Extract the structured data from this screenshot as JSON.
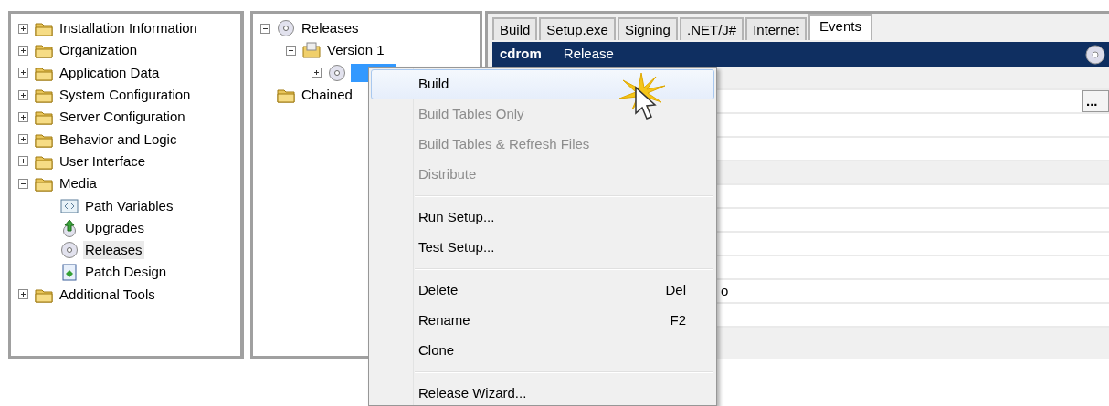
{
  "left_tree": {
    "items": [
      {
        "label": "Installation Information",
        "kind": "folder",
        "expanded": false
      },
      {
        "label": "Organization",
        "kind": "folder",
        "expanded": false
      },
      {
        "label": "Application Data",
        "kind": "folder",
        "expanded": false
      },
      {
        "label": "System Configuration",
        "kind": "folder",
        "expanded": false
      },
      {
        "label": "Server Configuration",
        "kind": "folder",
        "expanded": false
      },
      {
        "label": "Behavior and Logic",
        "kind": "folder",
        "expanded": false
      },
      {
        "label": "User Interface",
        "kind": "folder",
        "expanded": false
      },
      {
        "label": "Media",
        "kind": "folder",
        "expanded": true,
        "children": [
          {
            "label": "Path Variables",
            "kind": "path",
            "selected": false
          },
          {
            "label": "Upgrades",
            "kind": "upgrade",
            "selected": false
          },
          {
            "label": "Releases",
            "kind": "disc",
            "selected": true
          },
          {
            "label": "Patch Design",
            "kind": "patch",
            "selected": false
          }
        ]
      },
      {
        "label": "Additional Tools",
        "kind": "folder",
        "expanded": false
      }
    ]
  },
  "release_tree": {
    "items": [
      {
        "label": "Releases",
        "kind": "disc",
        "expanded": true,
        "children": [
          {
            "label": "Version 1",
            "kind": "version",
            "expanded": true,
            "children": [
              {
                "kind": "disc",
                "expanded": false,
                "selected": true
              }
            ]
          }
        ]
      },
      {
        "label": "Chained",
        "kind": "folder",
        "selected": false
      }
    ]
  },
  "tabs": [
    {
      "label": "Build",
      "selected": false
    },
    {
      "label": "Setup.exe",
      "selected": false
    },
    {
      "label": "Signing",
      "selected": false
    },
    {
      "label": ".NET/J#",
      "selected": false
    },
    {
      "label": "Internet",
      "selected": false
    },
    {
      "label": "Events",
      "selected": true
    }
  ],
  "header": {
    "name": "cdrom",
    "type": "Release"
  },
  "grid_rows": [
    {
      "kind": "group"
    },
    {
      "kind": "button",
      "button": "..."
    },
    {
      "kind": "plain"
    },
    {
      "kind": "plain"
    },
    {
      "kind": "group"
    },
    {
      "kind": "plain"
    },
    {
      "kind": "plain"
    },
    {
      "kind": "plain"
    },
    {
      "kind": "plain"
    },
    {
      "kind": "plain",
      "value": "o"
    },
    {
      "kind": "plain"
    }
  ],
  "context_menu": [
    {
      "kind": "item",
      "label": "Build",
      "disabled": false,
      "selected": true
    },
    {
      "kind": "item",
      "label": "Build Tables Only",
      "disabled": true,
      "selected": false
    },
    {
      "kind": "item",
      "label": "Build Tables & Refresh Files",
      "disabled": true,
      "selected": false
    },
    {
      "kind": "item",
      "label": "Distribute",
      "disabled": true,
      "selected": false
    },
    {
      "kind": "separator"
    },
    {
      "kind": "item",
      "label": "Run Setup...",
      "disabled": false,
      "selected": false
    },
    {
      "kind": "item",
      "label": "Test Setup...",
      "disabled": false,
      "selected": false
    },
    {
      "kind": "separator"
    },
    {
      "kind": "item",
      "label": "Delete",
      "shortcut": "Del",
      "disabled": false,
      "selected": false
    },
    {
      "kind": "item",
      "label": "Rename",
      "shortcut": "F2",
      "disabled": false,
      "selected": false
    },
    {
      "kind": "item",
      "label": "Clone",
      "disabled": false,
      "selected": false
    },
    {
      "kind": "separator"
    },
    {
      "kind": "item",
      "label": "Release Wizard...",
      "disabled": false,
      "selected": false
    }
  ]
}
